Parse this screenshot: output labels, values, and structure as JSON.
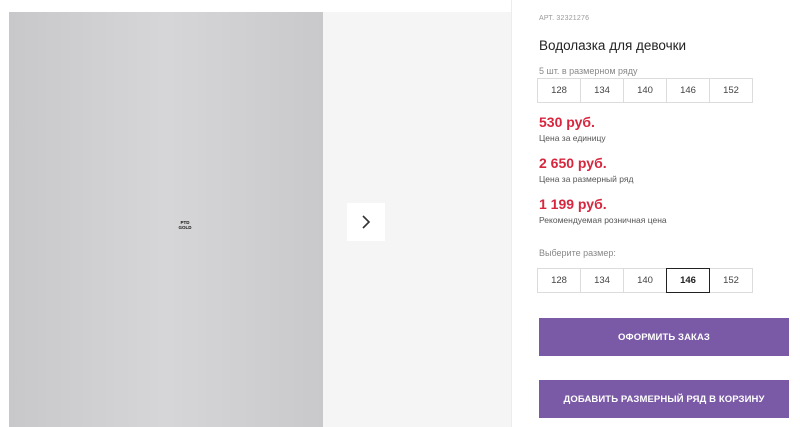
{
  "gallery": {
    "next_icon": "chevron-right-icon",
    "photo_logo_top": "PTD",
    "photo_logo_bottom": "GOLD"
  },
  "product": {
    "article_label": "АРТ. 32321276",
    "title": "Водолазка для девочки",
    "row_note": "5 шт. в размерном ряду",
    "row_sizes": [
      "128",
      "134",
      "140",
      "146",
      "152"
    ],
    "unit_price": "530 руб.",
    "unit_price_label": "Цена за единицу",
    "row_price": "2 650 руб.",
    "row_price_label": "Цена за размерный ряд",
    "retail_price": "1 199 руб.",
    "retail_price_label": "Рекомендуемая розничная цена",
    "choose_size_label": "Выберите размер:",
    "pick_sizes": [
      "128",
      "134",
      "140",
      "146",
      "152"
    ],
    "selected_size": "146"
  },
  "actions": {
    "order_label": "ОФОРМИТЬ ЗАКАЗ",
    "add_row_label": "ДОБАВИТЬ РАЗМЕРНЫЙ РЯД В КОРЗИНУ"
  },
  "colors": {
    "accent": "#7a5aa6",
    "price": "#d7263d"
  }
}
